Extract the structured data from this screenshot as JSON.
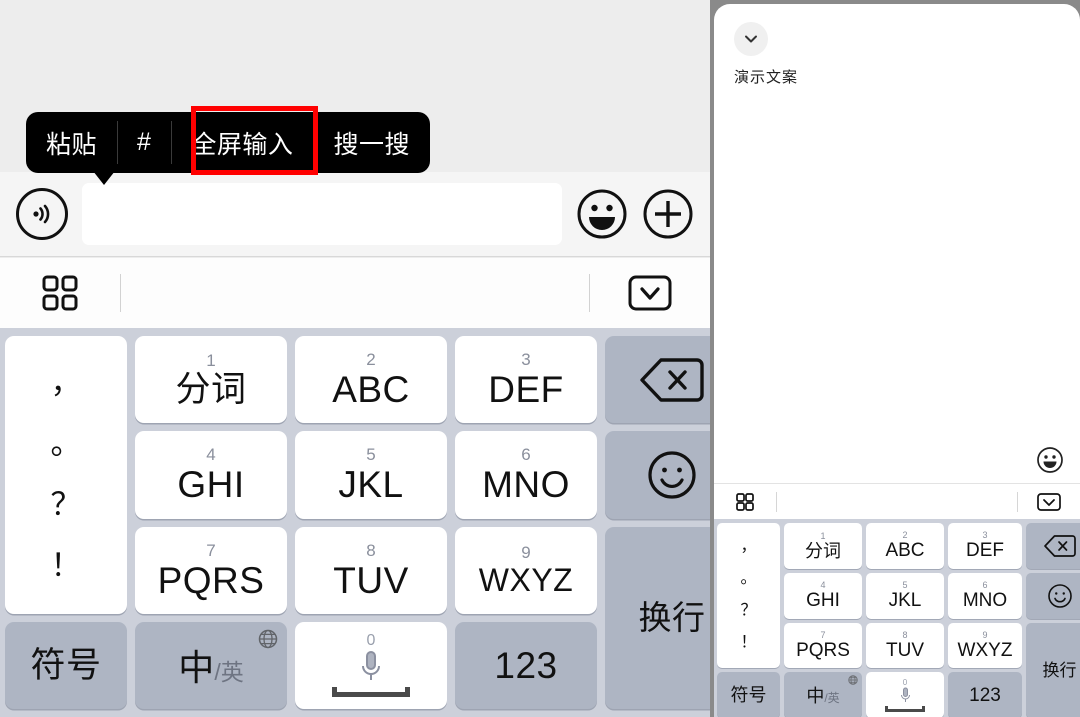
{
  "context_menu": {
    "items": [
      {
        "label": "粘贴",
        "name": "paste"
      },
      {
        "label": "#",
        "name": "hashtag"
      },
      {
        "label": "全屏输入",
        "name": "fullscreen-input",
        "highlighted": true
      },
      {
        "label": "搜一搜",
        "name": "search-it"
      }
    ],
    "highlight_color": "#ff0000"
  },
  "input_bar": {
    "voice_icon": "voice-wave-icon",
    "text_value": "",
    "placeholder": "",
    "emoji_icon": "emoji-face-icon",
    "plus_icon": "plus-circle-icon"
  },
  "keyboard_toolbar": {
    "grid_icon": "grid-apps-icon",
    "collapse_icon": "keyboard-collapse-icon"
  },
  "keyboard": {
    "punctuation": [
      "，",
      "。",
      "？",
      "！"
    ],
    "keys": [
      {
        "num": "1",
        "label": "分词",
        "type": "cn"
      },
      {
        "num": "2",
        "label": "ABC",
        "type": "latin"
      },
      {
        "num": "3",
        "label": "DEF",
        "type": "latin"
      },
      {
        "num": "4",
        "label": "GHI",
        "type": "latin"
      },
      {
        "num": "5",
        "label": "JKL",
        "type": "latin"
      },
      {
        "num": "6",
        "label": "MNO",
        "type": "latin"
      },
      {
        "num": "7",
        "label": "PQRS",
        "type": "latin"
      },
      {
        "num": "8",
        "label": "TUV",
        "type": "latin"
      },
      {
        "num": "9",
        "label": "WXYZ",
        "type": "latin"
      }
    ],
    "backspace_icon": "backspace-icon",
    "emoji_icon": "smiley-icon",
    "return_label": "换行",
    "symbol_label": "符号",
    "lang_zh": "中",
    "lang_slash": "/",
    "lang_en": "英",
    "globe_icon": "globe-icon",
    "space_zero": "0",
    "space_mic_icon": "microphone-icon",
    "numeric_label": "123"
  },
  "right_panel": {
    "chevron_icon": "chevron-down-icon",
    "note_text": "演示文案",
    "emoji_icon": "emoji-face-icon",
    "toolbar": {
      "grid_icon": "grid-apps-icon",
      "collapse_icon": "keyboard-collapse-icon"
    }
  },
  "colors": {
    "menu_bg": "#000000",
    "highlight": "#ff0000",
    "keyboard_bg": "#ccd0da",
    "fn_key": "#aeb5c3",
    "panel_bg": "#ededed"
  }
}
